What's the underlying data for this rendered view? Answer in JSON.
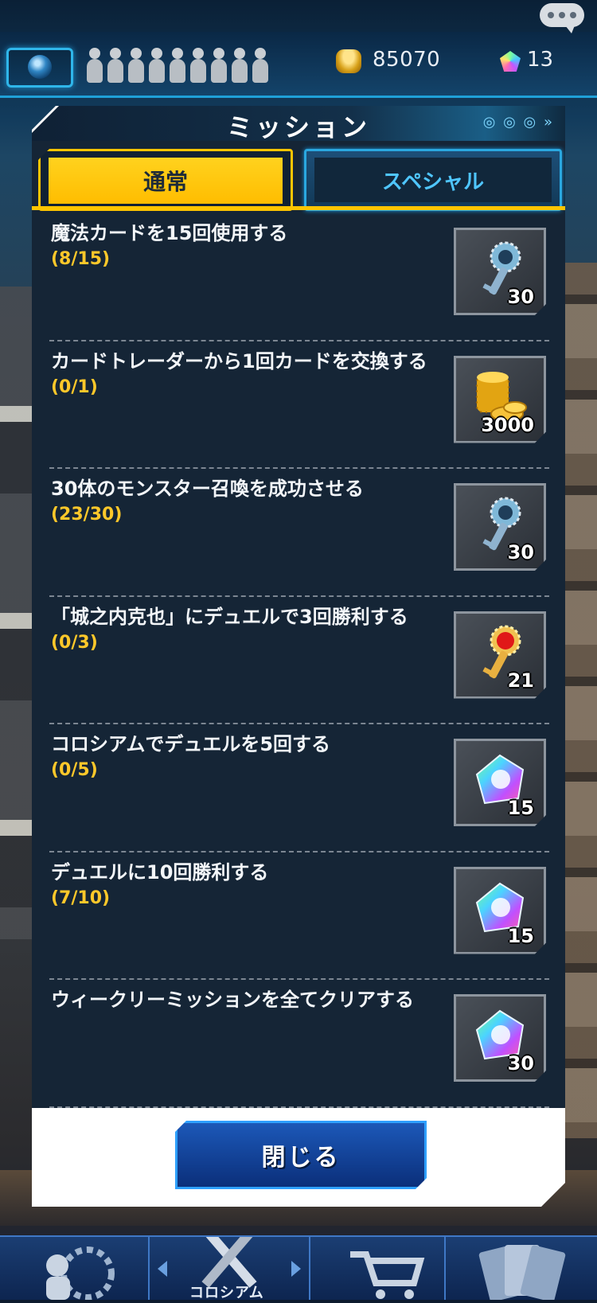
{
  "topbar": {
    "coins": "85070",
    "gems": "13",
    "slots_count": 9
  },
  "modal": {
    "title": "ミッション",
    "tabs": [
      {
        "label": "通常",
        "active": true
      },
      {
        "label": "スペシャル",
        "active": false
      }
    ],
    "missions": [
      {
        "text": "魔法カードを15回使用する",
        "progress": "(8/15)",
        "reward_icon": "blue-key-icon",
        "reward_count": "30"
      },
      {
        "text": "カードトレーダーから1回カードを交換する",
        "progress": "(0/1)",
        "reward_icon": "gold-coins-icon",
        "reward_count": "3000"
      },
      {
        "text": "30体のモンスター召喚を成功させる",
        "progress": "(23/30)",
        "reward_icon": "blue-key-icon",
        "reward_count": "30"
      },
      {
        "text": "「城之内克也」にデュエルで3回勝利する",
        "progress": "(0/3)",
        "reward_icon": "red-key-icon",
        "reward_count": "21"
      },
      {
        "text": "コロシアムでデュエルを5回する",
        "progress": "(0/5)",
        "reward_icon": "gem-icon",
        "reward_count": "15"
      },
      {
        "text": "デュエルに10回勝利する",
        "progress": "(7/10)",
        "reward_icon": "gem-icon",
        "reward_count": "15"
      },
      {
        "text": "ウィークリーミッションを全てクリアする",
        "progress": "",
        "reward_icon": "gem-icon",
        "reward_count": "30"
      }
    ],
    "close_label": "閉じる"
  },
  "bottomnav": {
    "colosseum_label": "コロシアム"
  },
  "colors": {
    "accent_yellow": "#ffc500",
    "accent_blue": "#2aa8e0",
    "panel_bg": "#152536",
    "progress_text": "#ffc82a"
  }
}
